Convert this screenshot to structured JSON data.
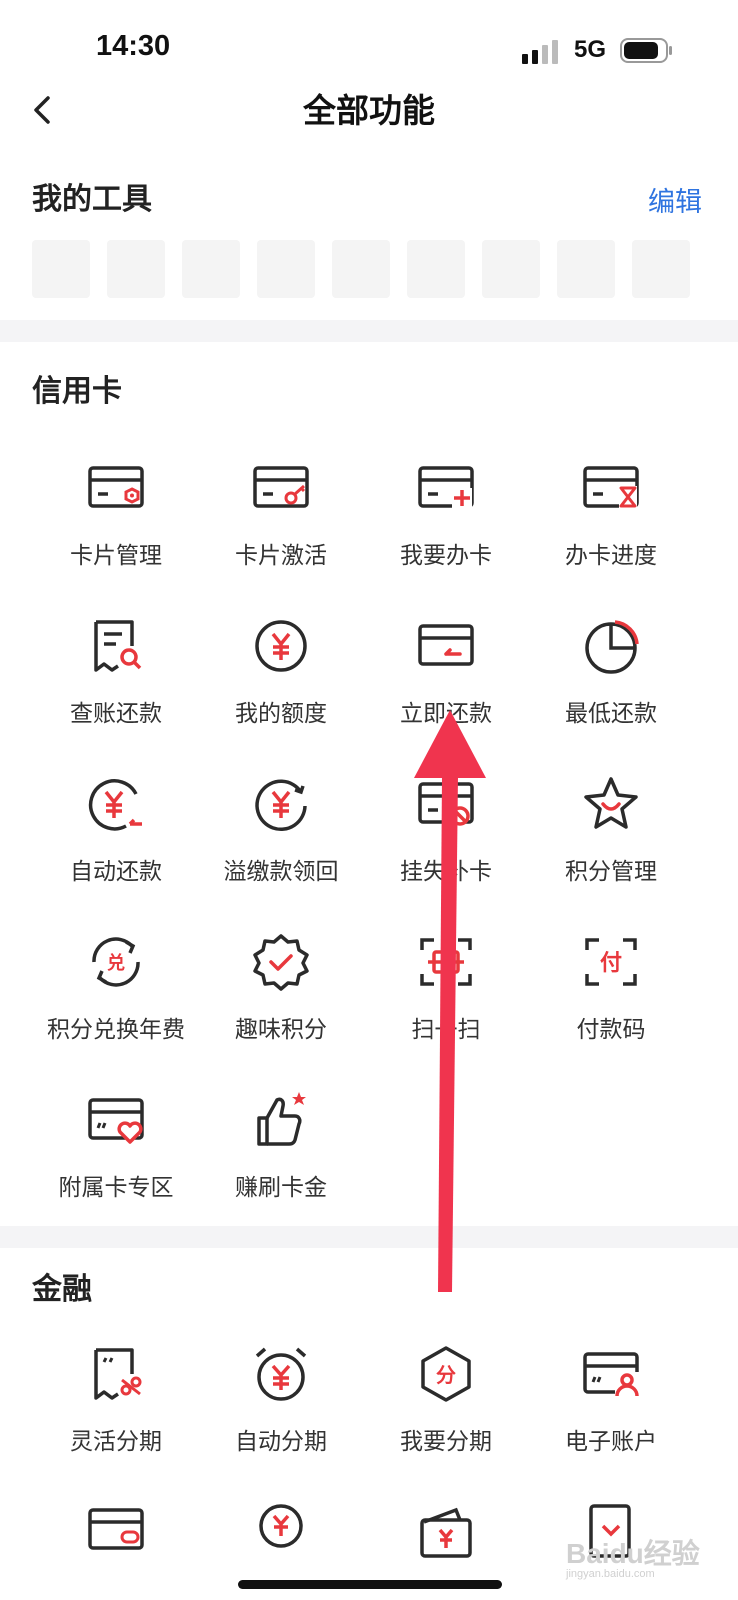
{
  "status": {
    "time": "14:30",
    "network": "5G"
  },
  "nav": {
    "title": "全部功能"
  },
  "my_tools": {
    "heading": "我的工具",
    "edit_label": "编辑",
    "slot_count": 9
  },
  "credit": {
    "heading": "信用卡",
    "items": [
      {
        "label": "卡片管理",
        "icon": "card-settings-icon"
      },
      {
        "label": "卡片激活",
        "icon": "card-key-icon"
      },
      {
        "label": "我要办卡",
        "icon": "card-add-icon"
      },
      {
        "label": "办卡进度",
        "icon": "card-hourglass-icon"
      },
      {
        "label": "查账还款",
        "icon": "bill-search-icon"
      },
      {
        "label": "我的额度",
        "icon": "yuan-circle-icon"
      },
      {
        "label": "立即还款",
        "icon": "card-return-icon"
      },
      {
        "label": "最低还款",
        "icon": "pie-chart-icon"
      },
      {
        "label": "自动还款",
        "icon": "yuan-auto-icon"
      },
      {
        "label": "溢缴款领回",
        "icon": "yuan-refresh-icon"
      },
      {
        "label": "挂失补卡",
        "icon": "card-block-icon"
      },
      {
        "label": "积分管理",
        "icon": "star-icon"
      },
      {
        "label": "积分兑换年费",
        "icon": "exchange-icon"
      },
      {
        "label": "趣味积分",
        "icon": "badge-check-icon"
      },
      {
        "label": "扫一扫",
        "icon": "scan-icon"
      },
      {
        "label": "付款码",
        "icon": "pay-code-icon"
      },
      {
        "label": "附属卡专区",
        "icon": "card-heart-icon"
      },
      {
        "label": "赚刷卡金",
        "icon": "thumbs-up-icon"
      }
    ]
  },
  "finance": {
    "heading": "金融",
    "items": [
      {
        "label": "灵活分期",
        "icon": "bill-scissors-icon"
      },
      {
        "label": "自动分期",
        "icon": "alarm-yuan-icon"
      },
      {
        "label": "我要分期",
        "icon": "hexagon-fen-icon"
      },
      {
        "label": "电子账户",
        "icon": "card-user-icon"
      }
    ],
    "partial_icons": [
      "card-link-icon",
      "hand-yuan-icon",
      "wallet-yuan-icon",
      "note-edit-icon"
    ]
  },
  "watermark": {
    "text": "Baidu经验",
    "sub": "jingyan.baidu.com"
  },
  "colors": {
    "accent": "#e8383d",
    "link": "#2f74e0",
    "icon_stroke": "#2b2b2b",
    "arrow": "#f0344e"
  }
}
